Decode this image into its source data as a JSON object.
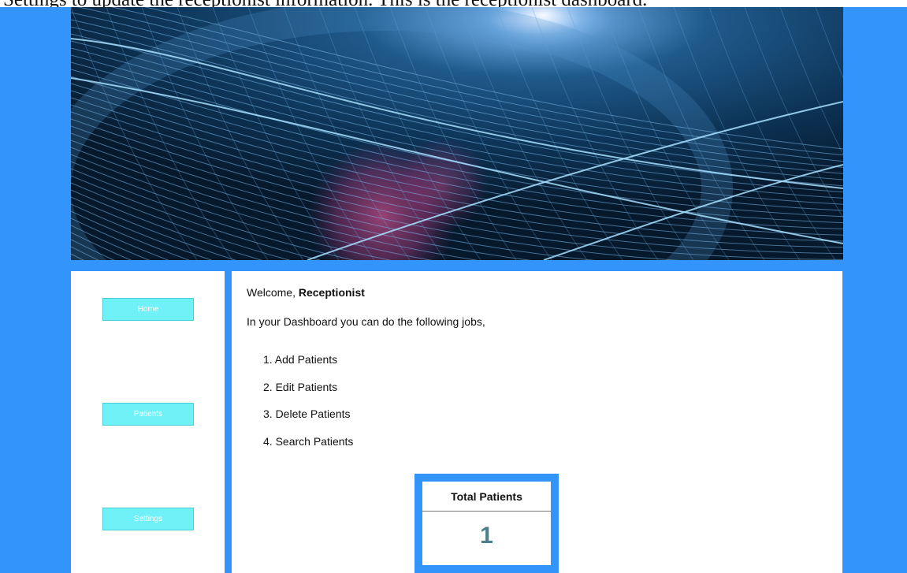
{
  "caption": {
    "text": "Settings to update the receptionist information. This is the receptionist dashboard."
  },
  "sidebar": {
    "items": [
      {
        "label": "Home"
      },
      {
        "label": "Patients"
      },
      {
        "label": "Settings"
      }
    ]
  },
  "main": {
    "welcome_prefix": "Welcome, ",
    "welcome_name": "Receptionist",
    "intro": "In your Dashboard you can do the following jobs,",
    "jobs": [
      "1. Add Patients",
      "2. Edit Patients",
      "3. Delete Patients",
      "4. Search Patients"
    ]
  },
  "card": {
    "title": "Total Patients",
    "value": "1"
  },
  "colors": {
    "page_background": "#3394fb",
    "nav_button": "#6ff1f7",
    "card_value": "#4b7f8a"
  },
  "icons": {
    "banner": "abstract-wave-banner-image"
  }
}
